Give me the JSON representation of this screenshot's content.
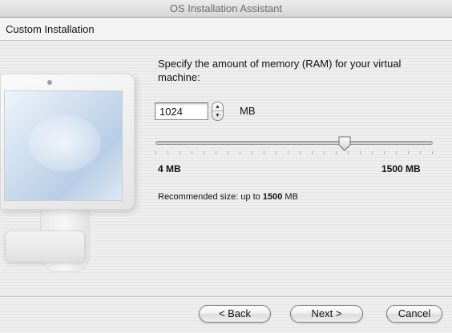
{
  "window": {
    "title": "OS Installation Assistant"
  },
  "header": {
    "title": "Custom Installation"
  },
  "memory": {
    "prompt": "Specify the amount of memory (RAM) for your virtual machine:",
    "value": "1024",
    "unit": "MB",
    "slider": {
      "min": 4,
      "max": 1500,
      "value": 1024,
      "tick_count": 24
    },
    "min_label": "4 MB",
    "max_label": "1500 MB",
    "recommend_prefix": "Recommended size: up to ",
    "recommend_value": "1500",
    "recommend_suffix": " MB"
  },
  "buttons": {
    "back": "< Back",
    "next": "Next >",
    "cancel": "Cancel"
  },
  "icons": {
    "stepper_up": "triangle-up",
    "stepper_down": "triangle-down",
    "illustration": "computer-monitor"
  }
}
